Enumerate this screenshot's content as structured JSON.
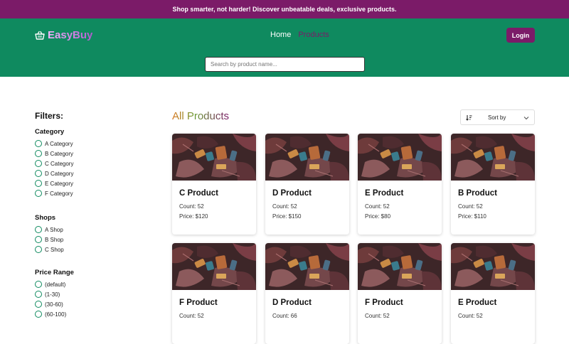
{
  "promo": {
    "text": "Shop smarter, not harder! Discover unbeatable deals, exclusive products."
  },
  "header": {
    "logo_text": "EasyBuy",
    "nav": {
      "home": "Home",
      "products": "Products"
    },
    "login_label": "Login",
    "search_placeholder": "Search by product name..."
  },
  "sidebar": {
    "title": "Filters:",
    "category": {
      "title": "Category",
      "options": [
        "A Category",
        "B Category",
        "C Category",
        "D Category",
        "E Category",
        "F Category"
      ]
    },
    "shops": {
      "title": "Shops",
      "options": [
        "A Shop",
        "B Shop",
        "C Shop"
      ]
    },
    "price": {
      "title": "Price Range",
      "options": [
        "(default)",
        "(1-30)",
        "(30-60)",
        "(60-100)"
      ]
    }
  },
  "main": {
    "title": "All Products",
    "sort_label": "Sort by",
    "products": [
      {
        "name": "C Product",
        "count": "Count: 52",
        "price": "Price: $120"
      },
      {
        "name": "D Product",
        "count": "Count: 52",
        "price": "Price: $150"
      },
      {
        "name": "E Product",
        "count": "Count: 52",
        "price": "Price: $80"
      },
      {
        "name": "B Product",
        "count": "Count: 52",
        "price": "Price: $110"
      },
      {
        "name": "F Product",
        "count": "Count: 52",
        "price": ""
      },
      {
        "name": "D Product",
        "count": "Count: 66",
        "price": ""
      },
      {
        "name": "F Product",
        "count": "Count: 52",
        "price": ""
      },
      {
        "name": "E Product",
        "count": "Count: 52",
        "price": ""
      }
    ]
  },
  "colors": {
    "promo_bg": "#7b1b68",
    "header_bg": "#0f8a5f",
    "accent": "#7b1b68"
  }
}
